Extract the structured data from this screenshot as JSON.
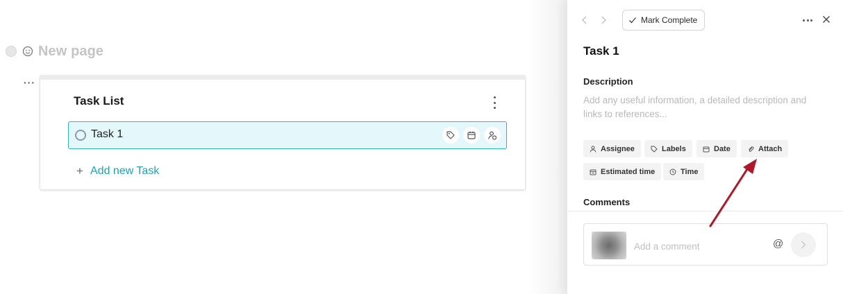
{
  "page": {
    "title": "New page"
  },
  "task_list": {
    "title": "Task List",
    "tasks": [
      {
        "name": "Task 1"
      }
    ],
    "add_label": "Add new Task",
    "row_icons": [
      "tag-icon",
      "calendar-icon",
      "assign-user-icon"
    ]
  },
  "panel": {
    "mark_complete_label": "Mark Complete",
    "task_title": "Task 1",
    "description_label": "Description",
    "description_placeholder": "Add any useful information, a detailed description and links to references...",
    "chips": [
      {
        "label": "Assignee",
        "icon": "user-icon"
      },
      {
        "label": "Labels",
        "icon": "tag-icon"
      },
      {
        "label": "Date",
        "icon": "calendar-icon"
      },
      {
        "label": "Attach",
        "icon": "paperclip-icon"
      },
      {
        "label": "Estimated time",
        "icon": "estimate-icon"
      },
      {
        "label": "Time",
        "icon": "clock-icon"
      }
    ],
    "comments_label": "Comments",
    "comment_placeholder": "Add a comment",
    "mention_symbol": "@"
  },
  "colors": {
    "accent": "#18a6b8",
    "task_row_bg": "#e4f7fa",
    "task_row_border": "#2fb4c3",
    "annotation_arrow": "#b0182a"
  }
}
